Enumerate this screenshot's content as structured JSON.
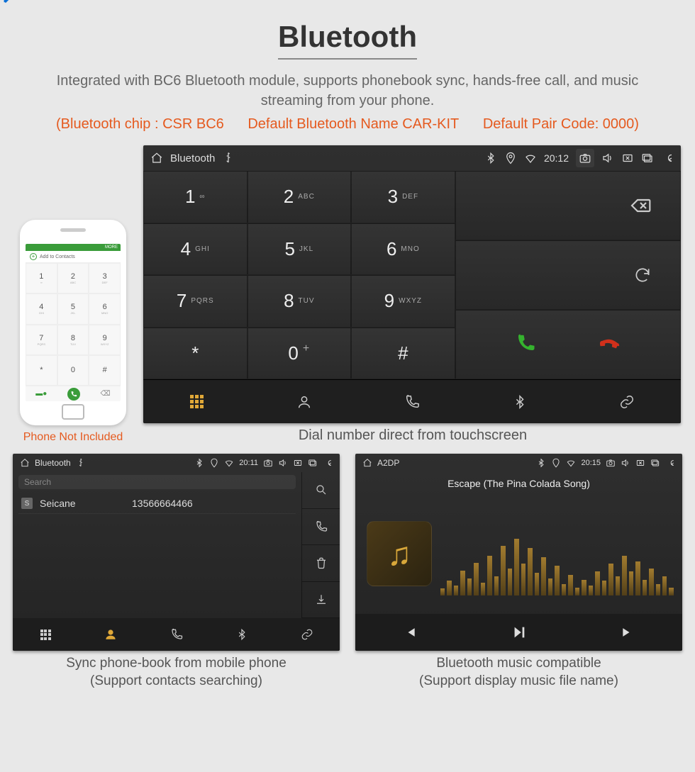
{
  "header": {
    "title": "Bluetooth",
    "description": "Integrated with BC6 Bluetooth module, supports phonebook sync, hands-free call, and music streaming from your phone.",
    "specs": {
      "chip": "(Bluetooth chip : CSR BC6",
      "name": "Default Bluetooth Name CAR-KIT",
      "pair": "Default Pair Code: 0000)"
    }
  },
  "phone_mock": {
    "note": "Phone Not Included",
    "add_contacts": "Add to Contacts",
    "more": "MORE"
  },
  "dialer": {
    "statusbar": {
      "title": "Bluetooth",
      "time": "20:12"
    },
    "keys": [
      {
        "num": "1",
        "ltr": "∞"
      },
      {
        "num": "2",
        "ltr": "ABC"
      },
      {
        "num": "3",
        "ltr": "DEF"
      },
      {
        "num": "4",
        "ltr": "GHI"
      },
      {
        "num": "5",
        "ltr": "JKL"
      },
      {
        "num": "6",
        "ltr": "MNO"
      },
      {
        "num": "7",
        "ltr": "PQRS"
      },
      {
        "num": "8",
        "ltr": "TUV"
      },
      {
        "num": "9",
        "ltr": "WXYZ"
      },
      {
        "num": "*",
        "ltr": ""
      },
      {
        "num": "0",
        "ltr": "+"
      },
      {
        "num": "#",
        "ltr": ""
      }
    ],
    "tabs": [
      "keypad",
      "contacts",
      "call-log",
      "bluetooth",
      "link"
    ],
    "caption": "Dial number direct from touchscreen"
  },
  "contacts_panel": {
    "statusbar": {
      "title": "Bluetooth",
      "time": "20:11"
    },
    "search_placeholder": "Search",
    "rows": [
      {
        "badge": "S",
        "name": "Seicane",
        "number": "13566664466"
      }
    ],
    "caption_line1": "Sync phone-book from mobile phone",
    "caption_line2": "(Support contacts searching)"
  },
  "music_panel": {
    "statusbar": {
      "title": "A2DP",
      "time": "20:15"
    },
    "track": "Escape (The Pina Colada Song)",
    "viz_bars": [
      12,
      26,
      18,
      44,
      30,
      58,
      22,
      70,
      34,
      88,
      48,
      100,
      56,
      84,
      40,
      68,
      30,
      52,
      20,
      36,
      14,
      28,
      18,
      42,
      26,
      56,
      34,
      70,
      42,
      60,
      28,
      48,
      20,
      34,
      14
    ],
    "caption_line1": "Bluetooth music compatible",
    "caption_line2": "(Support display music file name)"
  }
}
